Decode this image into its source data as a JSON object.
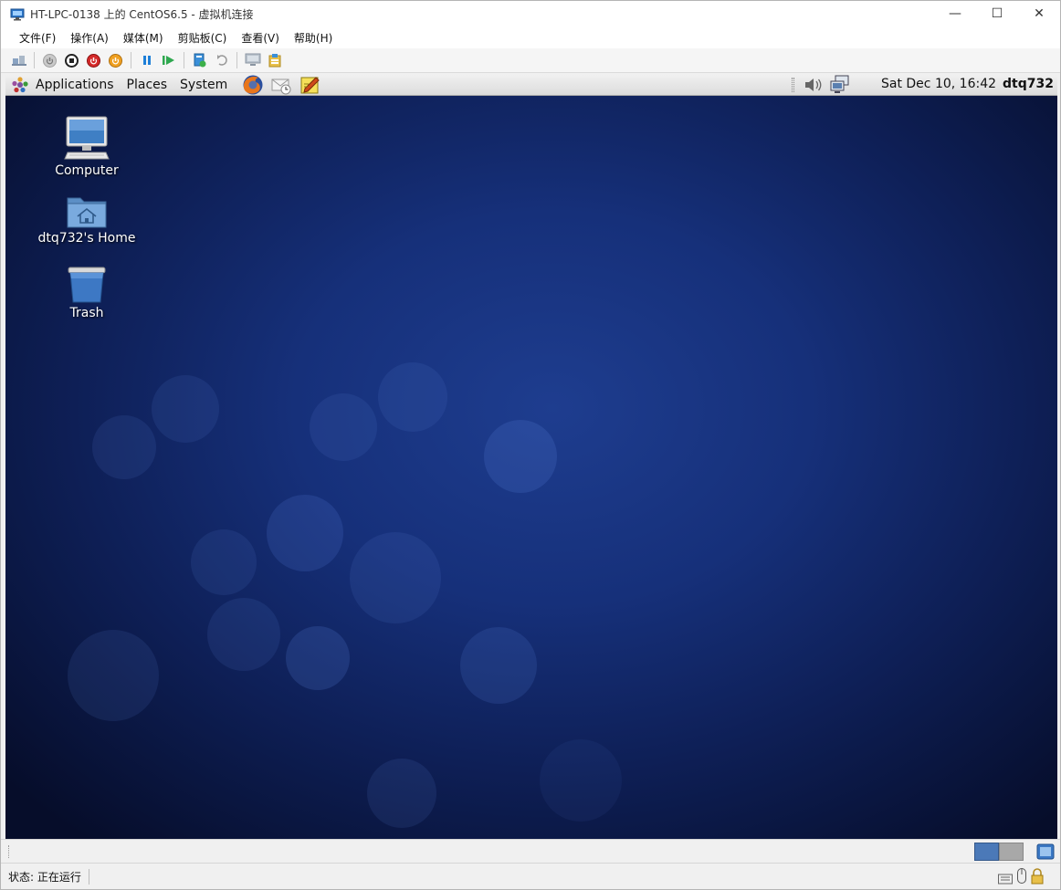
{
  "window": {
    "title": "HT-LPC-0138 上的 CentOS6.5 - 虚拟机连接",
    "minimize_glyph": "—",
    "maximize_glyph": "☐",
    "close_glyph": "✕"
  },
  "menubar": {
    "items": [
      "文件(F)",
      "操作(A)",
      "媒体(M)",
      "剪贴板(C)",
      "查看(V)",
      "帮助(H)"
    ]
  },
  "toolbar": {
    "icons": [
      "ctrl-alt-del-icon",
      "start-icon",
      "turn-off-icon",
      "shutdown-icon",
      "save-icon",
      "pause-icon",
      "resume-icon",
      "checkpoint-icon",
      "revert-icon",
      "enhanced-session-icon",
      "share-icon"
    ]
  },
  "guest": {
    "panel": {
      "menus": [
        "Applications",
        "Places",
        "System"
      ],
      "datetime": "Sat Dec 10, 16:42",
      "username": "dtq732"
    },
    "desktop_icons": [
      {
        "label": "Computer",
        "icon": "computer-icon"
      },
      {
        "label": "dtq732's Home",
        "icon": "home-folder-icon"
      },
      {
        "label": "Trash",
        "icon": "trash-icon"
      }
    ]
  },
  "statusbar": {
    "status_text": "状态: 正在运行"
  },
  "colors": {
    "desktop_center": "#1e3d8f",
    "desktop_edge": "#060d2a",
    "panel": "#e6e6e6",
    "window_bg": "#f0f0f0"
  }
}
